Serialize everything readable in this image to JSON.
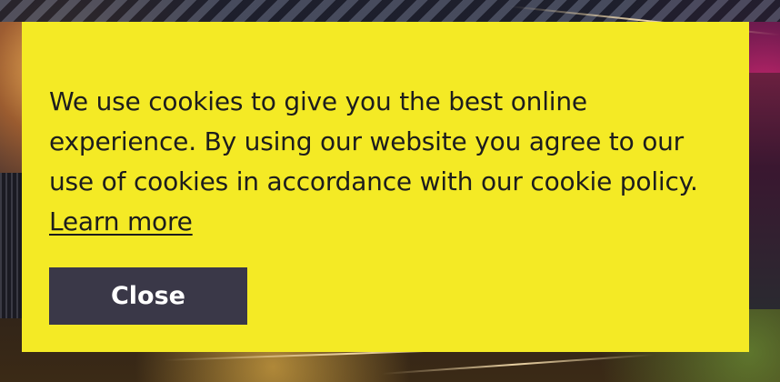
{
  "cookie_banner": {
    "message": "We use cookies to give you the best online experience. By using our website you agree to our use of cookies in accordance with our cookie policy.",
    "learn_more_label": "Learn more",
    "close_label": "Close"
  },
  "colors": {
    "banner_background": "#f4ea25",
    "button_background": "#3a3848",
    "button_text": "#ffffff",
    "text": "#1d1d1d"
  }
}
